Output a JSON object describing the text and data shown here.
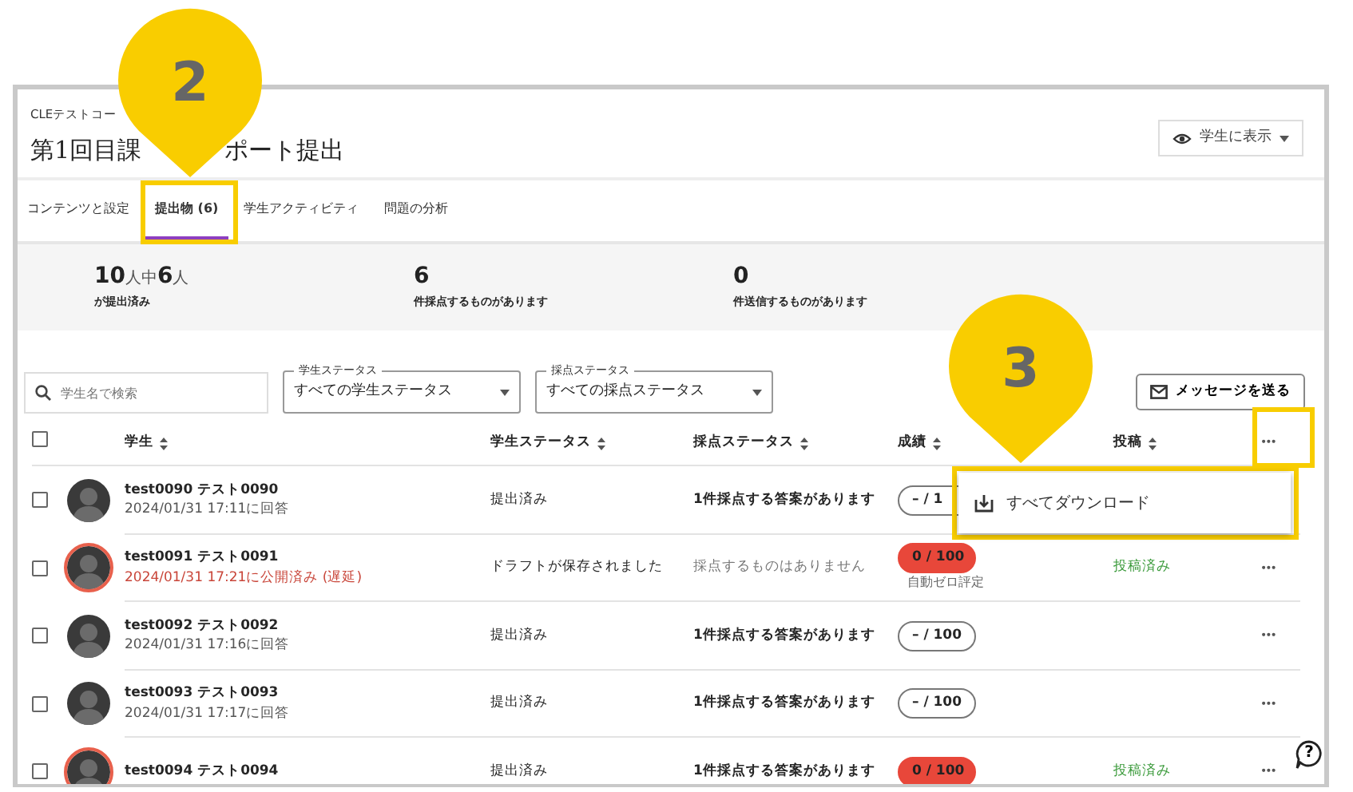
{
  "course": "CLEテストコー",
  "title_parts": [
    "第1回目課",
    "ポート提出"
  ],
  "view_button": {
    "label": "学生に表示"
  },
  "tabs": [
    {
      "label": "コンテンツと設定",
      "selected": false
    },
    {
      "label": "提出物 (6)",
      "selected": true
    },
    {
      "label": "学生アクティビティ",
      "selected": false
    },
    {
      "label": "問題の分析",
      "selected": false
    }
  ],
  "stats": [
    {
      "headline": "**10**人中**6**人",
      "caption": "が提出済み"
    },
    {
      "headline": "**6**",
      "caption": "件採点するものがあります"
    },
    {
      "headline": "**0**",
      "caption": "件送信するものがあります"
    }
  ],
  "search": {
    "placeholder": "学生名で検索"
  },
  "filters": [
    {
      "label": "学生ステータス",
      "value": "すべての学生ステータス"
    },
    {
      "label": "採点ステータス",
      "value": "すべての採点ステータス"
    }
  ],
  "message_button": "メッセージを送る",
  "select_all": {
    "checked": false
  },
  "columns": [
    "学生",
    "学生ステータス",
    "採点ステータス",
    "成績",
    "投稿"
  ],
  "more_button": "•••",
  "menu": {
    "items": [
      "すべてダウンロード"
    ]
  },
  "rows": [
    {
      "name": "test0090 テスト0090",
      "date": "2024/01/31 17:11に回答",
      "late": false,
      "checked": false,
      "student_status": "提出済み",
      "grading_status": "1件採点する答案があります",
      "grading_pending": true,
      "score": "– / 1",
      "auto_zero": false
    },
    {
      "name": "test0091 テスト0091",
      "date": "2024/01/31 17:21に公開済み (遅延)",
      "late": true,
      "checked": false,
      "student_status": "ドラフトが保存されました",
      "grading_status": "採点するものはありません",
      "grading_pending": false,
      "score": "0 / 100",
      "auto_zero": true,
      "score_note": "自動ゼロ評定",
      "post_status": "投稿済み",
      "more": "•••"
    },
    {
      "name": "test0092 テスト0092",
      "date": "2024/01/31 17:16に回答",
      "late": false,
      "checked": false,
      "student_status": "提出済み",
      "grading_status": "1件採点する答案があります",
      "grading_pending": true,
      "score": "– / 100",
      "auto_zero": false,
      "more": "•••"
    },
    {
      "name": "test0093 テスト0093",
      "date": "2024/01/31 17:17に回答",
      "late": false,
      "checked": false,
      "student_status": "提出済み",
      "grading_status": "1件採点する答案があります",
      "grading_pending": true,
      "score": "– / 100",
      "auto_zero": false,
      "more": "•••"
    },
    {
      "name": "test0094 テスト0094",
      "late": true,
      "checked": false,
      "student_status": "提出済み",
      "grading_status": "1件採点する答案があります",
      "grading_pending": true,
      "score": "0 / 100",
      "auto_zero": true,
      "post_status": "投稿済み",
      "more": "•••"
    }
  ],
  "help_button": "?",
  "callouts": [
    {
      "number": "2"
    },
    {
      "number": "3"
    }
  ]
}
